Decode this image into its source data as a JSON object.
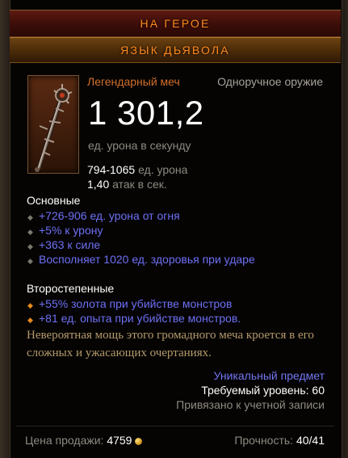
{
  "header": {
    "location_label": "НА ГЕРОЕ",
    "item_name": "ЯЗЫК ДЬЯВОЛА"
  },
  "item": {
    "icon": "ornate-spiked-sword-icon",
    "type_name": "Легендарный меч",
    "slot": "Одноручное оружие",
    "dps_value": "1 301,2",
    "dps_label": "ед. урона в секунду",
    "damage_range": "794-1065",
    "damage_unit": "ед. урона",
    "attack_speed": "1,40",
    "attack_speed_unit": "атак в сек."
  },
  "primary": {
    "heading": "Основные",
    "affixes": [
      "+726-906 ед. урона от огня",
      "+5% к урону",
      "+363 к силе",
      "Восполняет 1020 ед. здоровья при ударе"
    ]
  },
  "secondary": {
    "heading": "Второстепенные",
    "affixes": [
      "+55% золота при убийстве монстров",
      "+81 ед. опыта при убийстве монстров."
    ]
  },
  "flavor_text": "Невероятная мощь этого громадного меча кроется в его сложных и ужасающих очертаниях.",
  "meta": {
    "rarity_label": "Уникальный предмет",
    "required_level": "Требуемый уровень: 60",
    "bound": "Привязано к учетной записи"
  },
  "footer": {
    "sell_label": "Цена продажи:",
    "sell_value": "4759",
    "durability_label": "Прочность:",
    "durability_value": "40/41"
  },
  "colors": {
    "legendary_orange": "#ff8a1d",
    "affix_blue": "#6e6ff4",
    "flavor_tan": "#b59a6c",
    "muted_gray": "#8f8a80"
  }
}
